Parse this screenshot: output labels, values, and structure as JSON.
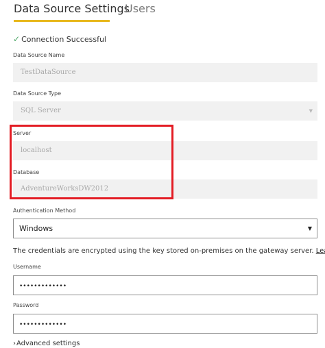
{
  "tabs": {
    "data_source_settings": "Data Source Settings",
    "users": "Users"
  },
  "status": {
    "check_icon": "✓",
    "text": "Connection Successful"
  },
  "data_source_name": {
    "label": "Data Source Name",
    "value": "TestDataSource"
  },
  "data_source_type": {
    "label": "Data Source Type",
    "value": "SQL Server",
    "arrow": "▼"
  },
  "server": {
    "label": "Server",
    "value": "localhost"
  },
  "database": {
    "label": "Database",
    "value": "AdventureWorksDW2012"
  },
  "authentication": {
    "label": "Authentication Method",
    "value": "Windows",
    "arrow": "▼"
  },
  "credentials_note": {
    "text": "The credentials are encrypted using the key stored on-premises on the gateway server. ",
    "link": "Learn more"
  },
  "username": {
    "label": "Username",
    "value": "•••••••••••••"
  },
  "password": {
    "label": "Password",
    "value": "•••••••••••••"
  },
  "advanced": {
    "chevron": "›",
    "label": "Advanced settings"
  },
  "colors": {
    "tab_underline": "#e8b81d",
    "highlight_border": "#e31c24",
    "success_check": "#4aa564",
    "disabled_field": "#f1f1f1"
  }
}
